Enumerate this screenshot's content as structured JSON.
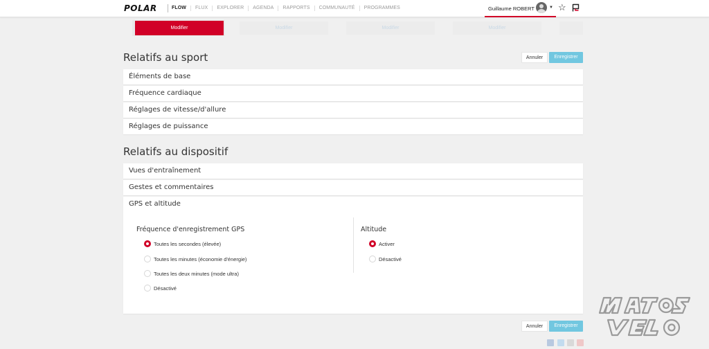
{
  "header": {
    "logo": "POLAR",
    "nav": [
      "FLOW",
      "FLUX",
      "EXPLORER",
      "AGENDA",
      "RAPPORTS",
      "COMMUNAUTÉ",
      "PROGRAMMES"
    ],
    "user_name": "Guillaume ROBERT"
  },
  "devices": {
    "modify_label": "Modifier"
  },
  "sport_section": {
    "title": "Relatifs au sport",
    "cancel_label": "Annuler",
    "save_label": "Enregistrer",
    "rows": [
      "Éléments de base",
      "Fréquence cardiaque",
      "Réglages de vitesse/d'allure",
      "Réglages de puissance"
    ]
  },
  "device_section": {
    "title": "Relatifs au dispositif",
    "rows": [
      "Vues d'entraînement",
      "Gestes et commentaires"
    ],
    "gps": {
      "title": "GPS et altitude",
      "frequency_title": "Fréquence d'enregistrement GPS",
      "frequency_options": [
        "Toutes les secondes (élevée)",
        "Toutes les minutes (économie d'énergie)",
        "Toutes les deux minutes (mode ultra)",
        "Désactivé"
      ],
      "frequency_selected": 0,
      "altitude_title": "Altitude",
      "altitude_options": [
        "Activer",
        "Désactivé"
      ],
      "altitude_selected": 0
    }
  },
  "footer": {
    "cancel_label": "Annuler",
    "save_label": "Enregistrer"
  },
  "colors": {
    "accent": "#d10027",
    "save_button": "#5bc0de",
    "background": "#f0f0f0"
  }
}
